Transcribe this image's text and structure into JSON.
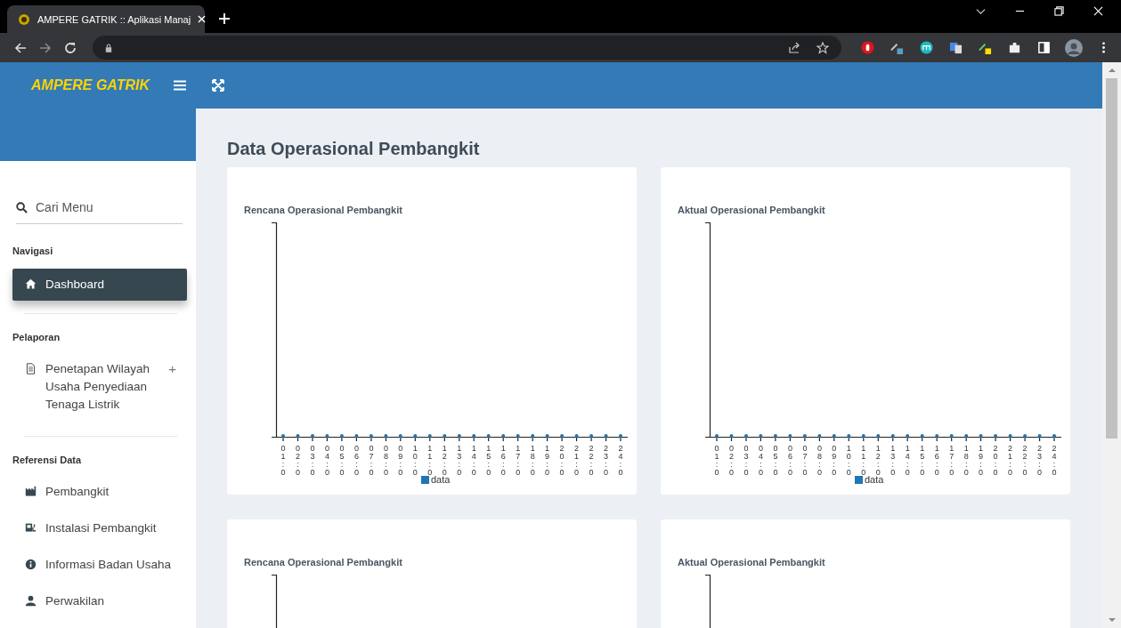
{
  "browser": {
    "tab_title": "AMPERE GATRIK :: Aplikasi Manaj"
  },
  "header": {
    "logo": "AMPERE GATRIK"
  },
  "sidebar": {
    "search_placeholder": "Cari Menu",
    "sections": [
      {
        "heading": "Navigasi",
        "items": [
          {
            "label": "Dashboard",
            "selected": true
          }
        ]
      },
      {
        "heading": "Pelaporan",
        "items": [
          {
            "label": "Penetapan Wilayah Usaha Penyediaan Tenaga Listrik",
            "selected": false,
            "toggle": "+"
          }
        ]
      },
      {
        "heading": "Referensi Data",
        "items": [
          {
            "label": "Pembangkit",
            "selected": false
          },
          {
            "label": "Instalasi Pembangkit",
            "selected": false
          },
          {
            "label": "Informasi Badan Usaha",
            "selected": false
          },
          {
            "label": "Perwakilan",
            "selected": false
          }
        ]
      }
    ]
  },
  "content": {
    "title": "Data Operasional Pembangkit",
    "cards": [
      {
        "title": "Rencana Operasional Pembangkit",
        "legend": "data",
        "x_labels": [
          "01:0",
          "02:0",
          "03:0",
          "04:0",
          "05:0",
          "06:0",
          "07:0",
          "08:0",
          "09:0",
          "10:0",
          "11:0",
          "12:0",
          "13:0",
          "14:0",
          "15:0",
          "16:0",
          "17:0",
          "18:0",
          "19:0",
          "20:0",
          "21:0",
          "22:0",
          "23:0",
          "24:0"
        ]
      },
      {
        "title": "Aktual Operasional Pembangkit",
        "legend": "data",
        "x_labels": [
          "01:0",
          "02:0",
          "03:0",
          "04:0",
          "05:0",
          "06:0",
          "07:0",
          "08:0",
          "09:0",
          "10:0",
          "11:0",
          "12:0",
          "13:0",
          "14:0",
          "15:0",
          "16:0",
          "17:0",
          "18:0",
          "19:0",
          "20:0",
          "21:0",
          "22:0",
          "23:0",
          "24:0"
        ]
      },
      {
        "title": "Rencana Operasional Pembangkit"
      },
      {
        "title": "Aktual Operasional Pembangkit"
      }
    ]
  }
}
